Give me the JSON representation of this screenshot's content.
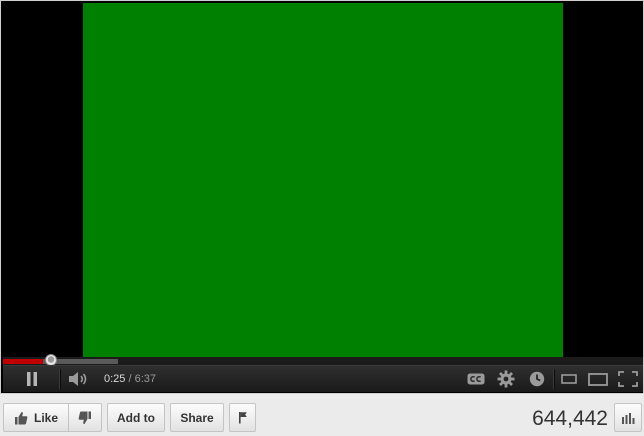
{
  "player": {
    "video_frame_color": "#008000",
    "progress": {
      "played_fraction": 0.063,
      "loaded_fraction": 0.18,
      "played_color": "#c00000"
    },
    "time": {
      "current": "0:25",
      "separator": "/",
      "duration": "6:37"
    },
    "controls": {
      "pause_icon": "pause-icon",
      "volume_icon": "volume-icon",
      "cc_icon": "cc-icon",
      "settings_icon": "gear-icon",
      "watch_later_icon": "clock-icon",
      "small_player_icon": "small-player-icon",
      "large_player_icon": "large-player-icon",
      "fullscreen_icon": "fullscreen-icon"
    }
  },
  "actions": {
    "like_label": "Like",
    "add_to_label": "Add to",
    "share_label": "Share",
    "view_count": "644,442"
  }
}
